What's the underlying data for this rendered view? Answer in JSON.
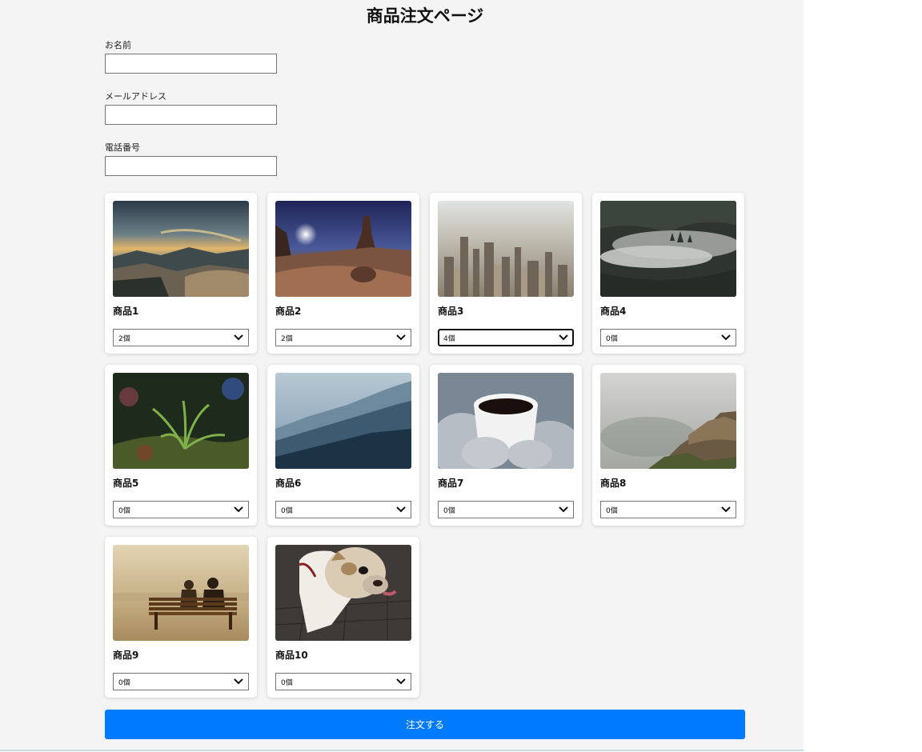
{
  "title": "商品注文ページ",
  "form": {
    "name_label": "お名前",
    "name_value": "",
    "email_label": "メールアドレス",
    "email_value": "",
    "phone_label": "電話番号",
    "phone_value": ""
  },
  "products": [
    {
      "name": "商品1",
      "quantity": "2個",
      "image": "mountain-sunset-photo"
    },
    {
      "name": "商品2",
      "quantity": "2個",
      "image": "desert-night-moon-photo"
    },
    {
      "name": "商品3",
      "quantity": "4個",
      "image": "city-aerial-photo"
    },
    {
      "name": "商品4",
      "quantity": "0個",
      "image": "foggy-forest-photo"
    },
    {
      "name": "商品5",
      "quantity": "0個",
      "image": "plant-closeup-photo"
    },
    {
      "name": "商品6",
      "quantity": "0個",
      "image": "misty-mountains-photo"
    },
    {
      "name": "商品7",
      "quantity": "0個",
      "image": "coffee-cup-photo"
    },
    {
      "name": "商品8",
      "quantity": "0個",
      "image": "foggy-cliff-photo"
    },
    {
      "name": "商品9",
      "quantity": "0個",
      "image": "couple-bench-photo"
    },
    {
      "name": "商品10",
      "quantity": "0個",
      "image": "bulldog-photo"
    }
  ],
  "submit_label": "注文する",
  "colors": {
    "accent": "#007bff",
    "page_background": "#f4f4f4",
    "card_background": "#ffffff"
  }
}
